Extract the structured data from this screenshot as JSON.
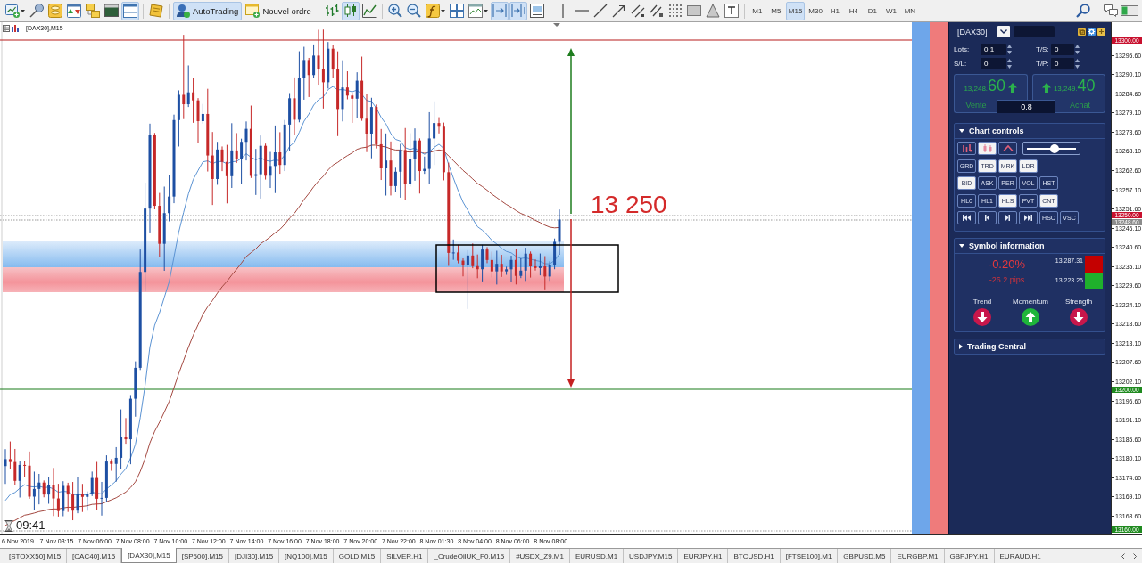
{
  "toolbar": {
    "file_tools": [
      {
        "selected": false
      },
      {
        "selected": false
      },
      {
        "selected": false
      },
      {
        "selected": false
      },
      {
        "selected": false
      },
      {
        "selected": false
      },
      {
        "selected": true
      }
    ],
    "editor_tools": [
      {
        "selected": false
      }
    ],
    "autotrading": {
      "label": "AutoTrading",
      "on": true
    },
    "new_order": {
      "label": "Nouvel ordre"
    },
    "chart_types": [
      {
        "selected": false
      },
      {
        "selected": true
      },
      {
        "selected": false
      }
    ],
    "view_tools": [
      {
        "selected": false
      },
      {
        "selected": false
      },
      {
        "selected": false
      },
      {
        "selected": false
      },
      {
        "selected": false
      },
      {
        "selected": true
      },
      {
        "selected": true
      },
      {
        "selected": false
      }
    ],
    "drawing_tools": [
      {
        "selected": false
      },
      {
        "selected": false
      },
      {
        "selected": false
      },
      {
        "selected": false
      },
      {
        "selected": false
      },
      {
        "selected": false
      },
      {
        "selected": false
      },
      {
        "selected": false
      },
      {
        "selected": false
      },
      {
        "selected": false
      }
    ],
    "timeframes": [
      {
        "label": "M1",
        "selected": false
      },
      {
        "label": "M5",
        "selected": false
      },
      {
        "label": "M15",
        "selected": true
      },
      {
        "label": "M30",
        "selected": false
      },
      {
        "label": "H1",
        "selected": false
      },
      {
        "label": "H4",
        "selected": false
      },
      {
        "label": "D1",
        "selected": false
      },
      {
        "label": "W1",
        "selected": false
      },
      {
        "label": "MN",
        "selected": false
      }
    ]
  },
  "chart": {
    "title": "[DAX30],M15",
    "target_label": "13 250",
    "countdown": "09:41"
  },
  "price_axis": {
    "labels": [
      "13295.60",
      "13290.10",
      "13284.60",
      "13279.10",
      "13273.60",
      "13268.10",
      "13262.60",
      "13257.10",
      "13251.60",
      "13246.10",
      "13240.60",
      "13235.10",
      "13229.60",
      "13224.10",
      "13218.60",
      "13213.10",
      "13207.60",
      "13202.10",
      "13196.60",
      "13191.10",
      "13185.60",
      "13180.10",
      "13174.60",
      "13169.10",
      "13163.60"
    ],
    "markers": [
      {
        "label": "13300.00",
        "color": "#c8102e"
      },
      {
        "label": "13250.00",
        "color": "#c8102e"
      },
      {
        "label": "13248.60",
        "color": "#8c8c8c"
      },
      {
        "label": "13200.00",
        "color": "#1f8a1f"
      },
      {
        "label": "13160.00",
        "color": "#1f8a1f"
      }
    ]
  },
  "time_axis": {
    "labels": [
      "6 Nov 2019",
      "7 Nov 03:15",
      "7 Nov 06:00",
      "7 Nov 08:00",
      "7 Nov 10:00",
      "7 Nov 12:00",
      "7 Nov 14:00",
      "7 Nov 16:00",
      "7 Nov 18:00",
      "7 Nov 20:00",
      "7 Nov 22:00",
      "8 Nov 01:30",
      "8 Nov 04:00",
      "8 Nov 06:00",
      "8 Nov 08:00"
    ]
  },
  "trade_panel": {
    "symbol": "[DAX30]",
    "fields": [
      {
        "label": "Lots:",
        "value": "0.1"
      },
      {
        "label": "T/S:",
        "value": "0"
      },
      {
        "label": "S/L:",
        "value": "0"
      },
      {
        "label": "T/P:",
        "value": "0"
      }
    ],
    "sell": {
      "big_figure": "13,248.",
      "pips": "60",
      "label": "Vente"
    },
    "buy": {
      "big_figure": "13,249.",
      "pips": "40",
      "label": "Achat"
    },
    "spread": "0.8"
  },
  "chart_controls": {
    "title": "Chart controls",
    "expanded": true,
    "tool_buttons": [
      {
        "on": false
      },
      {
        "on": true
      },
      {
        "on": false
      }
    ],
    "slider": {
      "level": 0.57
    },
    "button_rows": [
      [
        {
          "kind": "text",
          "label": "GRD",
          "on": false
        },
        {
          "kind": "text",
          "label": "TRD",
          "on": true
        },
        {
          "kind": "text",
          "label": "MRK",
          "on": true
        },
        {
          "kind": "text",
          "label": "LDR",
          "on": true
        }
      ],
      [
        {
          "kind": "text",
          "label": "BID",
          "on": true
        },
        {
          "kind": "text",
          "label": "ASK",
          "on": false
        },
        {
          "kind": "text",
          "label": "PER",
          "on": false
        },
        {
          "kind": "text",
          "label": "VOL",
          "on": false
        },
        {
          "kind": "text",
          "label": "HST",
          "on": false
        }
      ],
      [
        {
          "kind": "text",
          "label": "HL0",
          "on": false
        },
        {
          "kind": "text",
          "label": "HL1",
          "on": false
        },
        {
          "kind": "text",
          "label": "HLS",
          "on": true
        },
        {
          "kind": "text",
          "label": "PVT",
          "on": false
        },
        {
          "kind": "text",
          "label": "CNT",
          "on": true
        }
      ],
      [
        {
          "kind": "icon",
          "on": false
        },
        {
          "kind": "icon",
          "on": false
        },
        {
          "kind": "icon",
          "on": false
        },
        {
          "kind": "icon",
          "on": false
        },
        {
          "kind": "text",
          "label": "HSC",
          "on": false
        },
        {
          "kind": "text",
          "label": "VSC",
          "on": false
        }
      ]
    ]
  },
  "symbol_information": {
    "title": "Symbol information",
    "expanded": true,
    "change": "-0.20%",
    "pips": "-26.2 pips",
    "high": "13,287.31",
    "low": "13,223.26",
    "indicators": [
      {
        "label": "Trend",
        "up": false
      },
      {
        "label": "Momentum",
        "up": true
      },
      {
        "label": "Strength",
        "up": false
      }
    ]
  },
  "trading_central": {
    "title": "Trading Central",
    "expanded": false
  },
  "tabs": [
    {
      "label": "[STOXX50],M15",
      "selected": false
    },
    {
      "label": "[CAC40],M15",
      "selected": false
    },
    {
      "label": "[DAX30],M15",
      "selected": true
    },
    {
      "label": "[SP500],M15",
      "selected": false
    },
    {
      "label": "[DJI30],M15",
      "selected": false
    },
    {
      "label": "[NQ100],M15",
      "selected": false
    },
    {
      "label": "GOLD,M15",
      "selected": false
    },
    {
      "label": "SILVER,H1",
      "selected": false
    },
    {
      "label": "_CrudeOilUK_F0,M15",
      "selected": false
    },
    {
      "label": "#USDX_Z9,M1",
      "selected": false
    },
    {
      "label": "EURUSD,M1",
      "selected": false
    },
    {
      "label": "USDJPY,M15",
      "selected": false
    },
    {
      "label": "EURJPY,H1",
      "selected": false
    },
    {
      "label": "BTCUSD,H1",
      "selected": false
    },
    {
      "label": "[FTSE100],M1",
      "selected": false
    },
    {
      "label": "GBPUSD,M5",
      "selected": false
    },
    {
      "label": "EURGBP,M1",
      "selected": false
    },
    {
      "label": "GBPJPY,H1",
      "selected": false
    },
    {
      "label": "EURAUD,H1",
      "selected": false
    }
  ]
}
